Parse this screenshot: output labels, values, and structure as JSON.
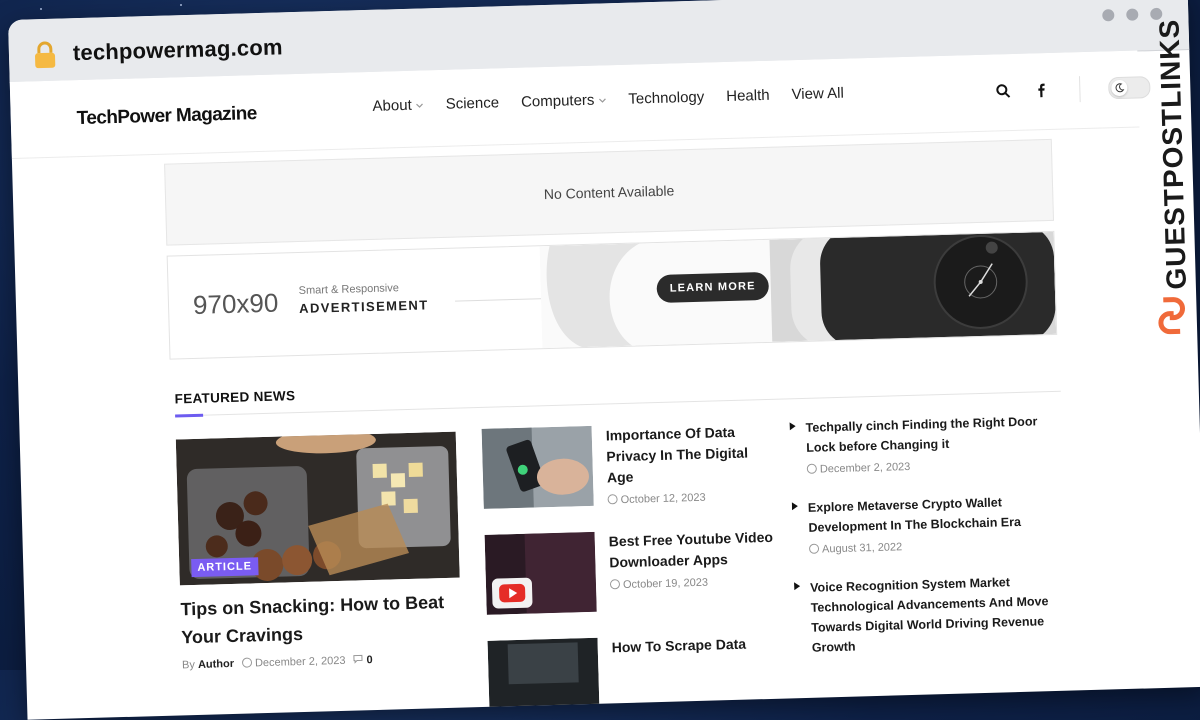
{
  "browser": {
    "url": "techpowermag.com"
  },
  "side_banner": {
    "text": "GUESTPOSTLINKS"
  },
  "site": {
    "brand": "TechPower Magazine"
  },
  "nav": {
    "items": [
      {
        "label": "About"
      },
      {
        "label": "Science"
      },
      {
        "label": "Computers"
      },
      {
        "label": "Technology"
      },
      {
        "label": "Health"
      },
      {
        "label": "View All"
      }
    ]
  },
  "notice": {
    "text": "No Content Available"
  },
  "ad": {
    "size": "970x90",
    "subtitle": "Smart & Responsive",
    "title": "ADVERTISEMENT",
    "cta": "LEARN MORE"
  },
  "featured": {
    "heading": "FEATURED NEWS",
    "main": {
      "badge": "ARTICLE",
      "title": "Tips on Snacking: How to Beat Your Cravings",
      "by": "By",
      "author": "Author",
      "date": "December 2, 2023",
      "comments": "0"
    },
    "middle": [
      {
        "title": "Importance Of Data Privacy In The Digital Age",
        "date": "October 12, 2023"
      },
      {
        "title": "Best Free Youtube Video Downloader Apps",
        "date": "October 19, 2023"
      },
      {
        "title": "How To Scrape Data",
        "date": ""
      }
    ],
    "right": [
      {
        "title": "Techpally cinch Finding the Right Door Lock before Changing it",
        "date": "December 2, 2023"
      },
      {
        "title": "Explore Metaverse Crypto Wallet Development In The Blockchain Era",
        "date": "August 31, 2022"
      },
      {
        "title": "Voice Recognition System Market Technological Advancements And Move Towards Digital World Driving Revenue Growth",
        "date": ""
      }
    ]
  },
  "colors": {
    "accent": "#7a5cf2",
    "background": "#0e2148"
  }
}
